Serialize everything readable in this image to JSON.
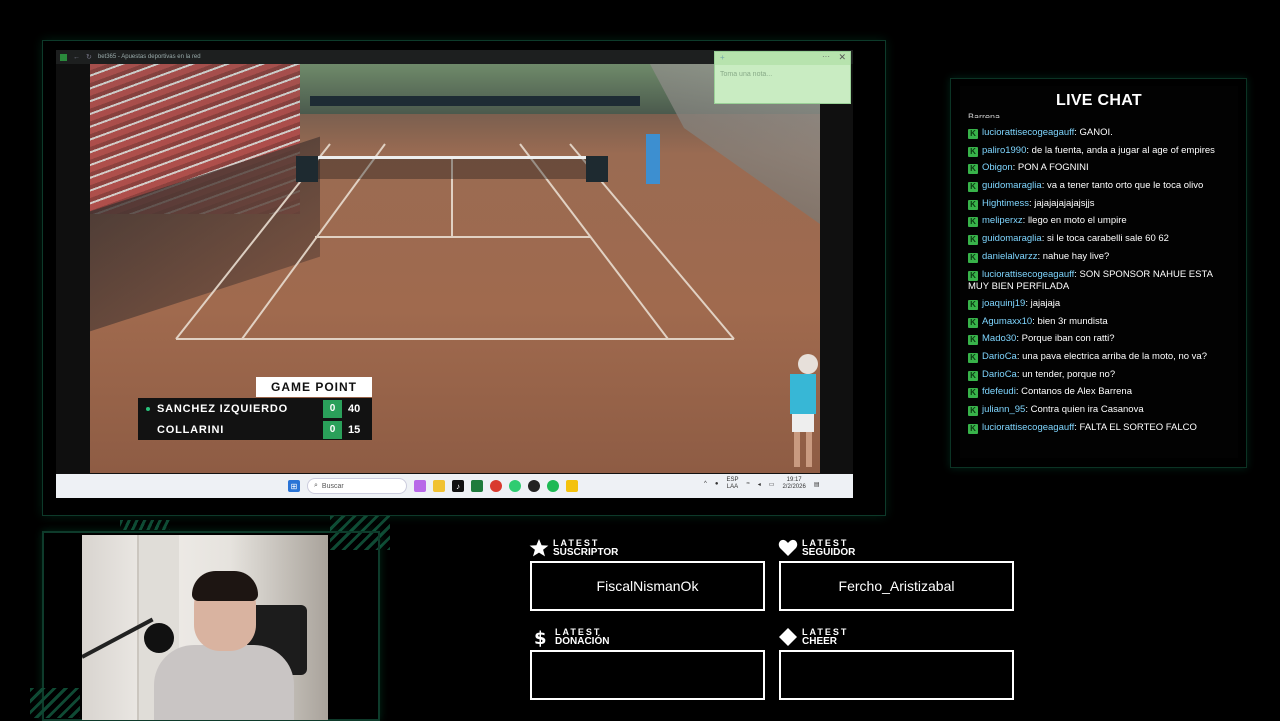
{
  "browser": {
    "tab_title": "bet365 - Apuestas deportivas en la red"
  },
  "scoreboard": {
    "label": "GAME POINT",
    "players": [
      {
        "name": "SANCHEZ IZQUIERDO",
        "sets": "0",
        "points": "40",
        "serving": true
      },
      {
        "name": "COLLARINI",
        "sets": "0",
        "points": "15",
        "serving": false
      }
    ],
    "accent_color": "#2aa05a"
  },
  "sticky_note": {
    "placeholder": "Toma una nota...",
    "menu": "···",
    "close": "✕",
    "add": "+"
  },
  "taskbar": {
    "search_placeholder": "Buscar",
    "lang_line1": "ESP",
    "lang_line2": "LAA",
    "time": "19:17",
    "date": "2/2/2026",
    "icons": [
      "windows-icon",
      "search-icon",
      "copilot-icon",
      "folder-icon",
      "tiktok-icon",
      "bet365-icon",
      "chrome-icon",
      "whatsapp-icon",
      "app-icon",
      "spotify-icon",
      "sticky-notes-icon"
    ]
  },
  "chat": {
    "title": "LIVE CHAT",
    "cut_line": "Barrena",
    "badge": "K",
    "messages": [
      {
        "user": "luciorattisecogeagauff",
        "text": "GANOI."
      },
      {
        "user": "paliro1990",
        "text": "de la fuenta, anda a jugar al age of empires"
      },
      {
        "user": "Obigon",
        "text": "PON A FOGNINI"
      },
      {
        "user": "guidomaraglia",
        "text": "va a tener tanto orto que le toca olivo"
      },
      {
        "user": "Hightimess",
        "text": "jajajajajajajsjjs"
      },
      {
        "user": "meliperxz",
        "text": "llego en moto el umpire"
      },
      {
        "user": "guidomaraglia",
        "text": "si le toca carabelli sale 60 62"
      },
      {
        "user": "danielalvarzz",
        "text": "nahue hay live?"
      },
      {
        "user": "luciorattisecogeagauff",
        "text": "SON SPONSOR NAHUE ESTA MUY BIEN PERFILADA"
      },
      {
        "user": "joaquinj19",
        "text": "jajajaja"
      },
      {
        "user": "Agumaxx10",
        "text": "bien 3r mundista"
      },
      {
        "user": "Mado30",
        "text": "Porque iban con ratti?"
      },
      {
        "user": "DarioCa",
        "text": "una pava electrica arriba de la moto, no va?"
      },
      {
        "user": "DarioCa",
        "text": "un tender, porque no?"
      },
      {
        "user": "fdefeudi",
        "text": "Contanos de Alex Barrena"
      },
      {
        "user": "juliann_95",
        "text": "Contra quien ira Casanova"
      },
      {
        "user": "luciorattisecogeagauff",
        "text": "FALTA EL SORTEO FALCO"
      }
    ]
  },
  "latest": {
    "suscriptor": {
      "small": "LATEST",
      "big": "SUSCRIPTOR",
      "value": "FiscalNismanOk",
      "icon": "star-icon"
    },
    "seguidor": {
      "small": "LATEST",
      "big": "SEGUIDOR",
      "value": "Fercho_Aristizabal",
      "icon": "heart-icon"
    },
    "donacion": {
      "small": "LATEST",
      "big": "DONACIÓN",
      "value": "",
      "icon": "dollar-icon"
    },
    "cheer": {
      "small": "LATEST",
      "big": "CHEER",
      "value": "",
      "icon": "diamond-icon"
    }
  }
}
